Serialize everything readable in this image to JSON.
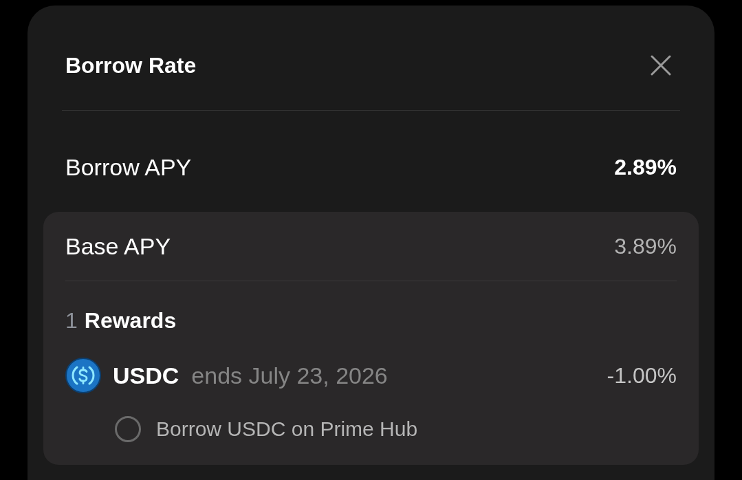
{
  "dialog": {
    "title": "Borrow Rate"
  },
  "summary": {
    "label": "Borrow APY",
    "value": "2.89%"
  },
  "breakdown": {
    "base": {
      "label": "Base APY",
      "value": "3.89%"
    },
    "rewards": {
      "count": "1",
      "label": "Rewards",
      "items": [
        {
          "token": "USDC",
          "ends": "ends July 23, 2026",
          "value": "-1.00%",
          "tasks": [
            {
              "label": "Borrow USDC on Prime Hub",
              "checked": false
            }
          ]
        }
      ]
    }
  }
}
